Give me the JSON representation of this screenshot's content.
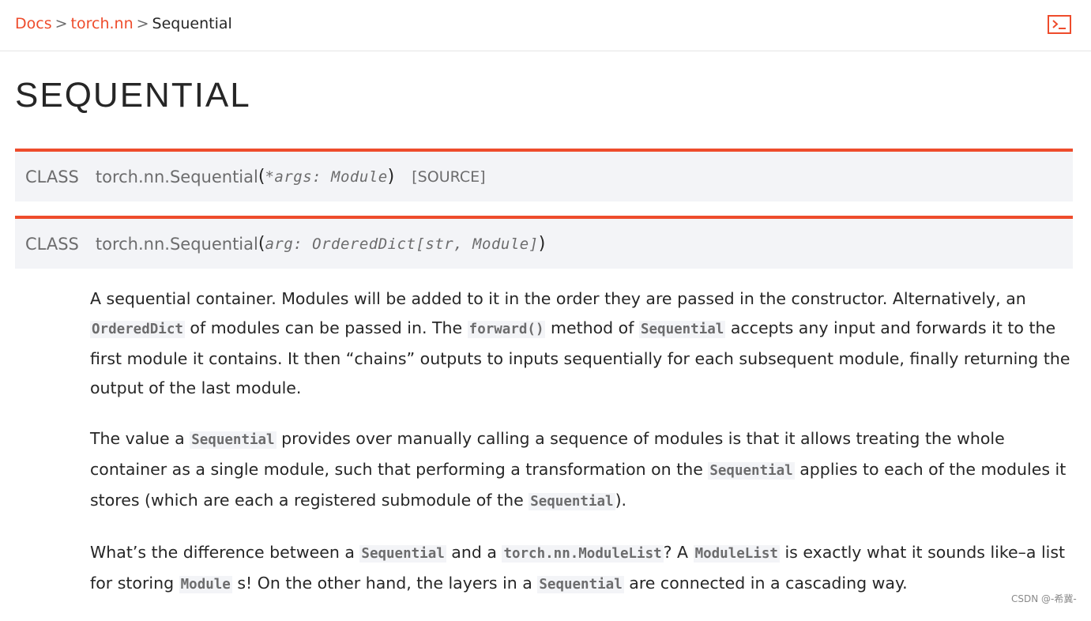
{
  "breadcrumb": {
    "item1": "Docs",
    "sep1": ">",
    "item2": "torch.nn",
    "sep2": ">",
    "current": "Sequential"
  },
  "header": {
    "shell_icon": "terminal-prompt-icon",
    "accent": "#ee4c2c"
  },
  "page_title": "SEQUENTIAL",
  "signatures": [
    {
      "keyword": "CLASS",
      "name": "torch.nn.Sequential",
      "open": "(",
      "params": "*args: Module",
      "close": ")",
      "source": "[SOURCE]"
    },
    {
      "keyword": "CLASS",
      "name": "torch.nn.Sequential",
      "open": "(",
      "params": "arg: OrderedDict[str, Module]",
      "close": ")"
    }
  ],
  "p1": {
    "t1": "A sequential container. Modules will be added to it in the order they are passed in the constructor. Alternatively, an ",
    "c1": "OrderedDict",
    "t2": " of modules can be passed in. The ",
    "c2": "forward()",
    "t3": " method of ",
    "c3": "Sequential",
    "t4": " accepts any input and forwards it to the first module it contains. It then “chains” outputs to inputs sequentially for each subsequent module, finally returning the output of the last module."
  },
  "p2": {
    "t1": "The value a ",
    "c1": "Sequential",
    "t2": " provides over manually calling a sequence of modules is that it allows treating the whole container as a single module, such that performing a transformation on the ",
    "c2": "Sequential",
    "t3": " applies to each of the modules it stores (which are each a registered submodule of the ",
    "c3": "Sequential",
    "t4": ")."
  },
  "p3": {
    "t1": "What’s the difference between a ",
    "c1": "Sequential",
    "t2": " and a ",
    "c2": "torch.nn.ModuleList",
    "t3": "? A ",
    "c3": "ModuleList",
    "t4": " is exactly what it sounds like–a list for storing ",
    "c4": "Module",
    "t5": " s! On the other hand, the layers in a ",
    "c5": "Sequential",
    "t6": " are connected in a cascading way."
  },
  "watermark": "CSDN @-希冀-"
}
